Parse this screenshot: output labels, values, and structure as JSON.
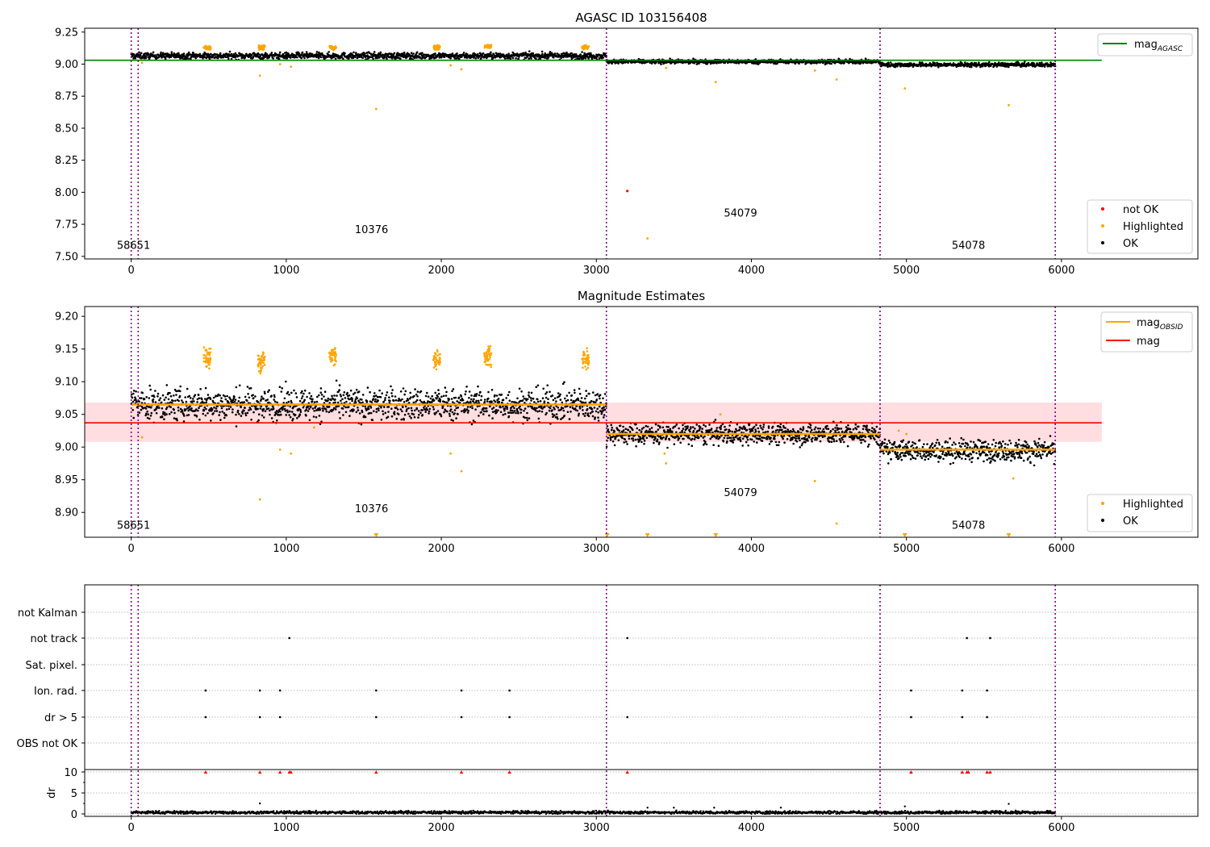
{
  "panels": {
    "mag": {
      "title": "AGASC ID 103156408",
      "obsid_labels": [
        "58651",
        "10376",
        "54079",
        "54078"
      ],
      "legend_lines": [
        {
          "main": "mag",
          "sub": "AGASC",
          "color": "#008000"
        }
      ],
      "legend_points": [
        {
          "label": "not OK",
          "color": "#ff0000"
        },
        {
          "label": "Highlighted",
          "color": "#ffa500"
        },
        {
          "label": "OK",
          "color": "#000000"
        }
      ]
    },
    "est": {
      "title": "Magnitude Estimates",
      "obsid_labels": [
        "58651",
        "10376",
        "54079",
        "54078"
      ],
      "legend_lines": [
        {
          "main": "mag",
          "sub": "OBSID",
          "color": "#ffa500"
        },
        {
          "main": "mag",
          "sub": "",
          "color": "#ff0000"
        }
      ],
      "legend_points": [
        {
          "label": "Highlighted",
          "color": "#ffa500"
        },
        {
          "label": "OK",
          "color": "#000000"
        }
      ]
    },
    "flags": {
      "categories": [
        "not Kalman",
        "not track",
        "Sat. pixel.",
        "Ion. rad.",
        "dr > 5",
        "OBS not OK"
      ],
      "dr_ylabel": "dr"
    }
  },
  "colors": {
    "ok": "#000000",
    "highlighted": "#ffa500",
    "not_ok": "#ff0000",
    "agasc": "#008000",
    "obs_boundary": "#800080",
    "band": "#ffdde0"
  },
  "chart_data": [
    {
      "type": "scatter",
      "title": "AGASC ID 103156408",
      "xlim": [
        -300,
        6880
      ],
      "ylim": [
        7.48,
        9.28
      ],
      "xticks": [
        0,
        1000,
        2000,
        3000,
        4000,
        5000,
        6000
      ],
      "yticks": [
        7.5,
        7.75,
        8.0,
        8.25,
        8.5,
        8.75,
        9.0,
        9.25
      ],
      "obs_boundaries": [
        0,
        45,
        3065,
        4830,
        5960
      ],
      "mag_agasc": 9.03,
      "mag_agasc_xrange": [
        -300,
        6260
      ],
      "obsid_label_positions": [
        [
          15,
          7.56
        ],
        [
          1550,
          7.68
        ],
        [
          3930,
          7.81
        ],
        [
          5400,
          7.56
        ]
      ],
      "series": [
        {
          "name": "OK",
          "segments": [
            {
              "x": [
                0,
                3065
              ],
              "y": 9.065,
              "spread": 0.012
            },
            {
              "x": [
                3065,
                4830
              ],
              "y": 9.02,
              "spread": 0.008
            },
            {
              "x": [
                4830,
                5960
              ],
              "y": 8.995,
              "spread": 0.008
            }
          ]
        },
        {
          "name": "Highlighted",
          "clusters": [
            {
              "x": 490,
              "y": 9.13
            },
            {
              "x": 840,
              "y": 9.13
            },
            {
              "x": 1300,
              "y": 9.13
            },
            {
              "x": 1970,
              "y": 9.13
            },
            {
              "x": 2300,
              "y": 9.14
            },
            {
              "x": 2930,
              "y": 9.13
            }
          ],
          "points": [
            [
              70,
              9.01
            ],
            [
              830,
              8.91
            ],
            [
              960,
              9.0
            ],
            [
              1030,
              8.98
            ],
            [
              1580,
              8.65
            ],
            [
              2060,
              8.99
            ],
            [
              2130,
              8.96
            ],
            [
              3330,
              7.64
            ],
            [
              3450,
              8.97
            ],
            [
              3770,
              8.86
            ],
            [
              4410,
              8.95
            ],
            [
              4550,
              8.88
            ],
            [
              4990,
              8.81
            ],
            [
              5660,
              8.68
            ]
          ]
        },
        {
          "name": "not OK",
          "points": [
            [
              3200,
              8.01
            ]
          ]
        }
      ]
    },
    {
      "type": "scatter",
      "title": "Magnitude Estimates",
      "xlim": [
        -300,
        6880
      ],
      "ylim": [
        8.862,
        9.215
      ],
      "xticks": [
        0,
        1000,
        2000,
        3000,
        4000,
        5000,
        6000
      ],
      "yticks": [
        8.9,
        8.95,
        9.0,
        9.05,
        9.1,
        9.15,
        9.2
      ],
      "obs_boundaries": [
        0,
        45,
        3065,
        4830,
        5960
      ],
      "mag": 9.037,
      "mag_band": [
        9.008,
        9.068
      ],
      "mag_xrange": [
        -300,
        6260
      ],
      "mag_obsid": [
        {
          "x": [
            0,
            3065
          ],
          "y": 9.065
        },
        {
          "x": [
            3065,
            4830
          ],
          "y": 9.02
        },
        {
          "x": [
            4830,
            5960
          ],
          "y": 8.996
        }
      ],
      "obsid_label_positions": [
        [
          15,
          8.875
        ],
        [
          1550,
          8.9
        ],
        [
          3930,
          8.925
        ],
        [
          5400,
          8.875
        ]
      ],
      "series": [
        {
          "name": "OK",
          "segments": [
            {
              "x": [
                0,
                3065
              ],
              "y": 9.065,
              "spread": 0.012
            },
            {
              "x": [
                3065,
                4830
              ],
              "y": 9.02,
              "spread": 0.008
            },
            {
              "x": [
                4830,
                5960
              ],
              "y": 8.995,
              "spread": 0.008
            }
          ]
        },
        {
          "name": "Highlighted",
          "clusters": [
            {
              "x": 490,
              "y": 9.135
            },
            {
              "x": 840,
              "y": 9.13
            },
            {
              "x": 1300,
              "y": 9.138
            },
            {
              "x": 1970,
              "y": 9.135
            },
            {
              "x": 2300,
              "y": 9.14
            },
            {
              "x": 2930,
              "y": 9.135
            }
          ],
          "points": [
            [
              70,
              9.015
            ],
            [
              830,
              8.92
            ],
            [
              960,
              8.996
            ],
            [
              1030,
              8.99
            ],
            [
              1180,
              9.03
            ],
            [
              2060,
              8.99
            ],
            [
              2130,
              8.963
            ],
            [
              3800,
              9.05
            ],
            [
              3450,
              8.975
            ],
            [
              3440,
              8.99
            ],
            [
              4410,
              8.948
            ],
            [
              4550,
              8.883
            ],
            [
              5690,
              8.952
            ],
            [
              4950,
              9.025
            ],
            [
              5000,
              9.02
            ]
          ],
          "offscale_low": [
            1580,
            3070,
            3330,
            3770,
            4990,
            5660
          ]
        }
      ]
    },
    {
      "type": "scatter",
      "title": "",
      "xlim": [
        -300,
        6880
      ],
      "xticks": [
        0,
        1000,
        2000,
        3000,
        4000,
        5000,
        6000
      ],
      "obs_boundaries": [
        0,
        45,
        3065,
        4830,
        5960
      ],
      "categories": [
        "not Kalman",
        "not track",
        "Sat. pixel.",
        "Ion. rad.",
        "dr > 5",
        "OBS not OK"
      ],
      "flag_points": {
        "not track": [
          1020,
          3200,
          5390,
          5540
        ],
        "Ion. rad.": [
          480,
          830,
          960,
          1580,
          2130,
          2440,
          5030,
          5360,
          5520
        ],
        "dr > 5": [
          480,
          830,
          960,
          1580,
          2130,
          2440,
          3200,
          5030,
          5360,
          5520
        ]
      },
      "dr_ylim": [
        0,
        10
      ],
      "dr_yticks": [
        0,
        5,
        10
      ],
      "dr_clipped": [
        480,
        830,
        960,
        1020,
        1030,
        1580,
        2130,
        2440,
        3200,
        5030,
        5360,
        5390,
        5400,
        5520,
        5540
      ],
      "dr_outliers": [
        [
          830,
          2.5
        ],
        [
          5660,
          2.4
        ],
        [
          3500,
          1.5
        ],
        [
          3330,
          1.5
        ],
        [
          3760,
          1.5
        ],
        [
          4990,
          1.8
        ],
        [
          4190,
          1.5
        ]
      ]
    }
  ]
}
